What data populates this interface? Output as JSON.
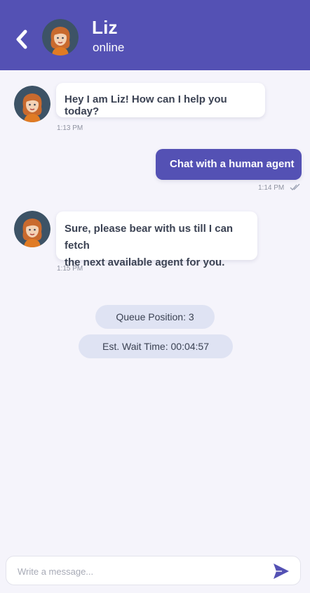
{
  "header": {
    "contact_name": "Liz",
    "status": "online"
  },
  "messages": [
    {
      "from": "bot",
      "text": "Hey I am Liz! How can I help you today?",
      "time": "1:13 PM"
    },
    {
      "from": "user",
      "text": "Chat with a human agent",
      "time": "1:14 PM"
    },
    {
      "from": "bot",
      "text_line1": "Sure, please bear with us till I can fetch",
      "text_line2": "the next available agent for you.",
      "time": "1:15 PM"
    }
  ],
  "queue": {
    "position": "Queue Position: 3",
    "wait_time": "Est. Wait Time: 00:04:57"
  },
  "composer": {
    "placeholder": "Write a message..."
  },
  "icons": {
    "back": "chevron-left-icon",
    "send": "send-icon",
    "read": "checkmark-icon"
  },
  "colors": {
    "accent": "#5451b4",
    "pill_bg": "#dfe3f3",
    "background": "#f5f4fb"
  }
}
